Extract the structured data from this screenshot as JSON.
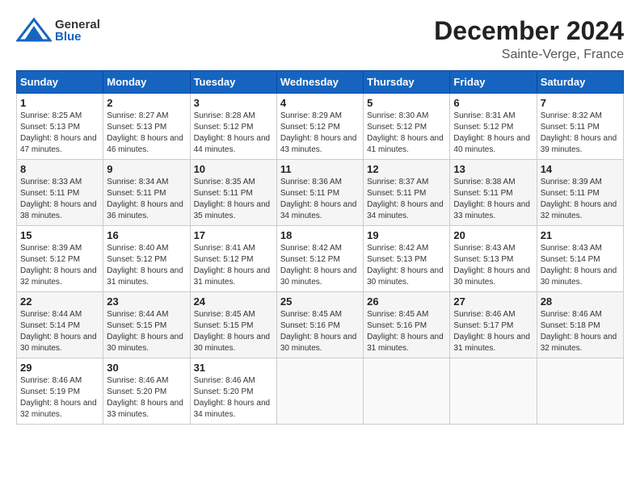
{
  "header": {
    "logo_general": "General",
    "logo_blue": "Blue",
    "month_title": "December 2024",
    "location": "Sainte-Verge, France"
  },
  "days_of_week": [
    "Sunday",
    "Monday",
    "Tuesday",
    "Wednesday",
    "Thursday",
    "Friday",
    "Saturday"
  ],
  "weeks": [
    [
      {
        "day": "1",
        "sunrise": "Sunrise: 8:25 AM",
        "sunset": "Sunset: 5:13 PM",
        "daylight": "Daylight: 8 hours and 47 minutes."
      },
      {
        "day": "2",
        "sunrise": "Sunrise: 8:27 AM",
        "sunset": "Sunset: 5:13 PM",
        "daylight": "Daylight: 8 hours and 46 minutes."
      },
      {
        "day": "3",
        "sunrise": "Sunrise: 8:28 AM",
        "sunset": "Sunset: 5:12 PM",
        "daylight": "Daylight: 8 hours and 44 minutes."
      },
      {
        "day": "4",
        "sunrise": "Sunrise: 8:29 AM",
        "sunset": "Sunset: 5:12 PM",
        "daylight": "Daylight: 8 hours and 43 minutes."
      },
      {
        "day": "5",
        "sunrise": "Sunrise: 8:30 AM",
        "sunset": "Sunset: 5:12 PM",
        "daylight": "Daylight: 8 hours and 41 minutes."
      },
      {
        "day": "6",
        "sunrise": "Sunrise: 8:31 AM",
        "sunset": "Sunset: 5:12 PM",
        "daylight": "Daylight: 8 hours and 40 minutes."
      },
      {
        "day": "7",
        "sunrise": "Sunrise: 8:32 AM",
        "sunset": "Sunset: 5:11 PM",
        "daylight": "Daylight: 8 hours and 39 minutes."
      }
    ],
    [
      {
        "day": "8",
        "sunrise": "Sunrise: 8:33 AM",
        "sunset": "Sunset: 5:11 PM",
        "daylight": "Daylight: 8 hours and 38 minutes."
      },
      {
        "day": "9",
        "sunrise": "Sunrise: 8:34 AM",
        "sunset": "Sunset: 5:11 PM",
        "daylight": "Daylight: 8 hours and 36 minutes."
      },
      {
        "day": "10",
        "sunrise": "Sunrise: 8:35 AM",
        "sunset": "Sunset: 5:11 PM",
        "daylight": "Daylight: 8 hours and 35 minutes."
      },
      {
        "day": "11",
        "sunrise": "Sunrise: 8:36 AM",
        "sunset": "Sunset: 5:11 PM",
        "daylight": "Daylight: 8 hours and 34 minutes."
      },
      {
        "day": "12",
        "sunrise": "Sunrise: 8:37 AM",
        "sunset": "Sunset: 5:11 PM",
        "daylight": "Daylight: 8 hours and 34 minutes."
      },
      {
        "day": "13",
        "sunrise": "Sunrise: 8:38 AM",
        "sunset": "Sunset: 5:11 PM",
        "daylight": "Daylight: 8 hours and 33 minutes."
      },
      {
        "day": "14",
        "sunrise": "Sunrise: 8:39 AM",
        "sunset": "Sunset: 5:11 PM",
        "daylight": "Daylight: 8 hours and 32 minutes."
      }
    ],
    [
      {
        "day": "15",
        "sunrise": "Sunrise: 8:39 AM",
        "sunset": "Sunset: 5:12 PM",
        "daylight": "Daylight: 8 hours and 32 minutes."
      },
      {
        "day": "16",
        "sunrise": "Sunrise: 8:40 AM",
        "sunset": "Sunset: 5:12 PM",
        "daylight": "Daylight: 8 hours and 31 minutes."
      },
      {
        "day": "17",
        "sunrise": "Sunrise: 8:41 AM",
        "sunset": "Sunset: 5:12 PM",
        "daylight": "Daylight: 8 hours and 31 minutes."
      },
      {
        "day": "18",
        "sunrise": "Sunrise: 8:42 AM",
        "sunset": "Sunset: 5:12 PM",
        "daylight": "Daylight: 8 hours and 30 minutes."
      },
      {
        "day": "19",
        "sunrise": "Sunrise: 8:42 AM",
        "sunset": "Sunset: 5:13 PM",
        "daylight": "Daylight: 8 hours and 30 minutes."
      },
      {
        "day": "20",
        "sunrise": "Sunrise: 8:43 AM",
        "sunset": "Sunset: 5:13 PM",
        "daylight": "Daylight: 8 hours and 30 minutes."
      },
      {
        "day": "21",
        "sunrise": "Sunrise: 8:43 AM",
        "sunset": "Sunset: 5:14 PM",
        "daylight": "Daylight: 8 hours and 30 minutes."
      }
    ],
    [
      {
        "day": "22",
        "sunrise": "Sunrise: 8:44 AM",
        "sunset": "Sunset: 5:14 PM",
        "daylight": "Daylight: 8 hours and 30 minutes."
      },
      {
        "day": "23",
        "sunrise": "Sunrise: 8:44 AM",
        "sunset": "Sunset: 5:15 PM",
        "daylight": "Daylight: 8 hours and 30 minutes."
      },
      {
        "day": "24",
        "sunrise": "Sunrise: 8:45 AM",
        "sunset": "Sunset: 5:15 PM",
        "daylight": "Daylight: 8 hours and 30 minutes."
      },
      {
        "day": "25",
        "sunrise": "Sunrise: 8:45 AM",
        "sunset": "Sunset: 5:16 PM",
        "daylight": "Daylight: 8 hours and 30 minutes."
      },
      {
        "day": "26",
        "sunrise": "Sunrise: 8:45 AM",
        "sunset": "Sunset: 5:16 PM",
        "daylight": "Daylight: 8 hours and 31 minutes."
      },
      {
        "day": "27",
        "sunrise": "Sunrise: 8:46 AM",
        "sunset": "Sunset: 5:17 PM",
        "daylight": "Daylight: 8 hours and 31 minutes."
      },
      {
        "day": "28",
        "sunrise": "Sunrise: 8:46 AM",
        "sunset": "Sunset: 5:18 PM",
        "daylight": "Daylight: 8 hours and 32 minutes."
      }
    ],
    [
      {
        "day": "29",
        "sunrise": "Sunrise: 8:46 AM",
        "sunset": "Sunset: 5:19 PM",
        "daylight": "Daylight: 8 hours and 32 minutes."
      },
      {
        "day": "30",
        "sunrise": "Sunrise: 8:46 AM",
        "sunset": "Sunset: 5:20 PM",
        "daylight": "Daylight: 8 hours and 33 minutes."
      },
      {
        "day": "31",
        "sunrise": "Sunrise: 8:46 AM",
        "sunset": "Sunset: 5:20 PM",
        "daylight": "Daylight: 8 hours and 34 minutes."
      },
      null,
      null,
      null,
      null
    ]
  ]
}
